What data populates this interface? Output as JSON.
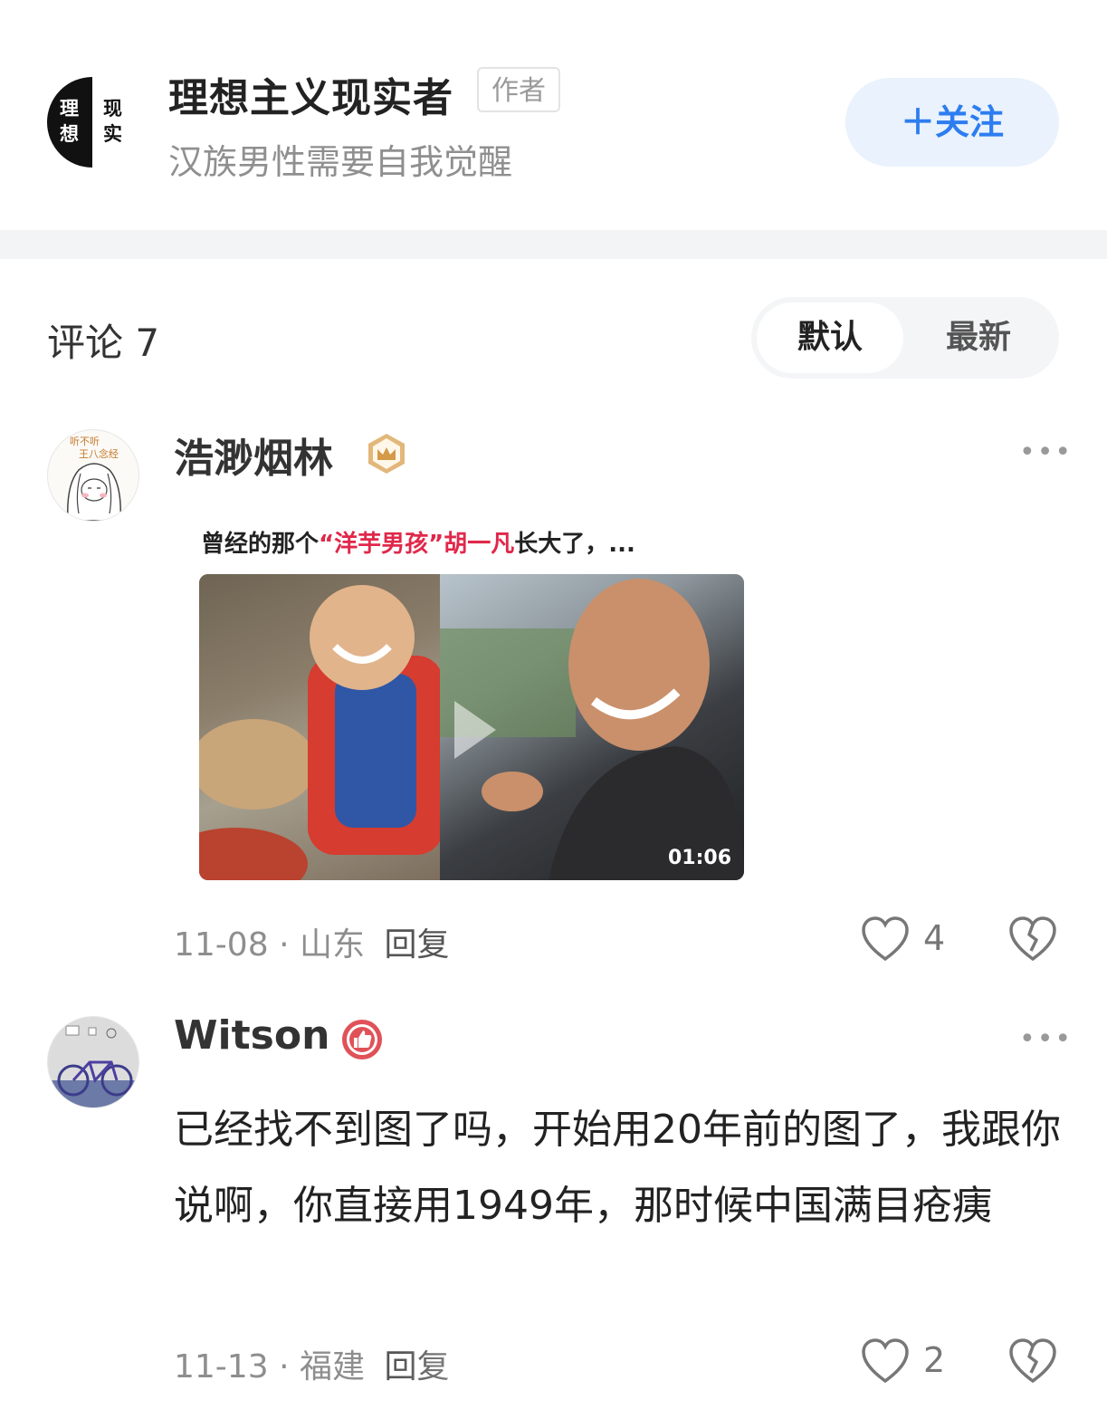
{
  "author": {
    "avatar_chars": [
      "理",
      "现",
      "想",
      "实"
    ],
    "name": "理想主义现实者",
    "badge": "作者",
    "bio": "汉族男性需要自我觉醒",
    "follow_label": "＋关注"
  },
  "comments_header": {
    "title": "评论 7",
    "sort_options": [
      "默认",
      "最新"
    ],
    "selected_sort": "默认"
  },
  "comments": [
    {
      "username": "浩渺烟林",
      "avatar_text": [
        "听不听",
        "王八念经"
      ],
      "video": {
        "caption_prefix": "曾经的那个",
        "caption_highlight": "“洋芋男孩”胡一凡",
        "caption_suffix": "长大了，...",
        "duration": "01:06"
      },
      "date": "11-08",
      "location": "山东",
      "reply_label": "回复",
      "likes": "4"
    },
    {
      "username": "Witson",
      "text": "已经找不到图了吗，开始用20年前的图了，我跟你说啊，你直接用1949年，那时候中国满目疮痍",
      "date": "11-13",
      "location": "福建",
      "reply_label": "回复",
      "likes": "2"
    }
  ],
  "colors": {
    "accent": "#2d7df0",
    "follow_bg": "#e9f2fd",
    "highlight": "#e0284a",
    "badge_gold": "#d4a35a",
    "badge_red": "#e05158"
  },
  "icons": [
    "more-dots-icon",
    "heart-outline-icon",
    "broken-heart-icon",
    "crown-badge-icon",
    "thumbs-up-badge-icon",
    "play-icon"
  ]
}
